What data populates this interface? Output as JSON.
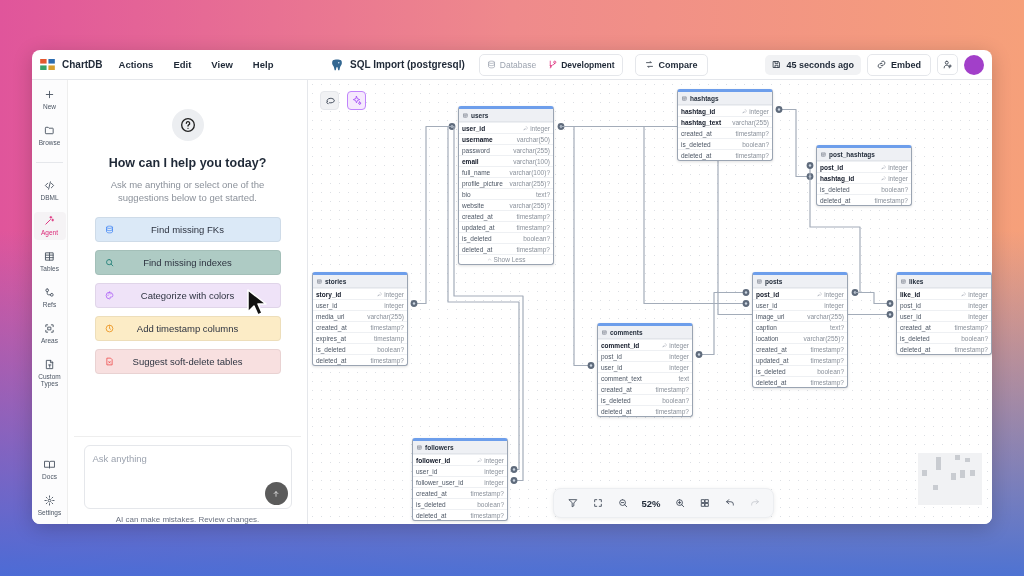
{
  "app": {
    "name": "ChartDB"
  },
  "menu": [
    "Actions",
    "Edit",
    "View",
    "Help"
  ],
  "diagram": {
    "name": "SQL Import (postgresql)"
  },
  "branches": [
    {
      "label": "Database",
      "selected": false
    },
    {
      "label": "Development",
      "selected": true
    }
  ],
  "compare_button": "Compare",
  "save_status": "45 seconds ago",
  "embed_button": "Embed",
  "rail": {
    "top": [
      {
        "label": "New",
        "selected": false
      },
      {
        "label": "Browse",
        "selected": false
      }
    ],
    "main": [
      {
        "label": "DBML",
        "selected": false
      },
      {
        "label": "Agent",
        "selected": true
      },
      {
        "label": "Tables",
        "selected": false
      },
      {
        "label": "Refs",
        "selected": false
      },
      {
        "label": "Areas",
        "selected": false
      },
      {
        "label": "Custom Types",
        "selected": false
      }
    ],
    "bottom": [
      {
        "label": "Docs",
        "selected": false
      },
      {
        "label": "Settings",
        "selected": false
      }
    ]
  },
  "agent": {
    "heading": "How can I help you today?",
    "subtitle": "Ask me anything or select one of the suggestions below to get started.",
    "suggestions": [
      {
        "label": "Find missing FKs",
        "color": "#dbe9f7"
      },
      {
        "label": "Find missing indexes",
        "color": "#aecbc4"
      },
      {
        "label": "Categorize with colors",
        "color": "#efe3f8"
      },
      {
        "label": "Add timestamp columns",
        "color": "#fcecc6"
      },
      {
        "label": "Suggest soft-delete tables",
        "color": "#f8e0e0"
      }
    ],
    "input": {
      "placeholder": "Ask anything"
    },
    "disclaimer": "AI can make mistakes. Review changes."
  },
  "canvas_tools": [
    {
      "selected": false
    },
    {
      "selected": true
    }
  ],
  "tables": [
    {
      "name": "users",
      "toggle": "Show Less",
      "fields": [
        {
          "name": "user_id",
          "type": "integer",
          "primary": true,
          "unique": false
        },
        {
          "name": "username",
          "type": "varchar(50)",
          "primary": false,
          "unique": true
        },
        {
          "name": "password",
          "type": "varchar(255)",
          "primary": false,
          "unique": false
        },
        {
          "name": "email",
          "type": "varchar(100)",
          "primary": false,
          "unique": true
        },
        {
          "name": "full_name",
          "type": "varchar(100)?",
          "primary": false,
          "unique": false
        },
        {
          "name": "profile_picture",
          "type": "varchar(255)?",
          "primary": false,
          "unique": false
        },
        {
          "name": "bio",
          "type": "text?",
          "primary": false,
          "unique": false
        },
        {
          "name": "website",
          "type": "varchar(255)?",
          "primary": false,
          "unique": false
        },
        {
          "name": "created_at",
          "type": "timestamp?",
          "primary": false,
          "unique": false
        },
        {
          "name": "updated_at",
          "type": "timestamp?",
          "primary": false,
          "unique": false
        },
        {
          "name": "is_deleted",
          "type": "boolean?",
          "primary": false,
          "unique": false
        },
        {
          "name": "deleted_at",
          "type": "timestamp?",
          "primary": false,
          "unique": false
        }
      ]
    },
    {
      "name": "hashtags",
      "fields": [
        {
          "name": "hashtag_id",
          "type": "integer",
          "primary": true,
          "unique": false
        },
        {
          "name": "hashtag_text",
          "type": "varchar(255)",
          "primary": false,
          "unique": true
        },
        {
          "name": "created_at",
          "type": "timestamp?",
          "primary": false,
          "unique": false
        },
        {
          "name": "is_deleted",
          "type": "boolean?",
          "primary": false,
          "unique": false
        },
        {
          "name": "deleted_at",
          "type": "timestamp?",
          "primary": false,
          "unique": false
        }
      ]
    },
    {
      "name": "post_hashtags",
      "fields": [
        {
          "name": "post_id",
          "type": "integer",
          "primary": true,
          "unique": false
        },
        {
          "name": "hashtag_id",
          "type": "integer",
          "primary": true,
          "unique": false
        },
        {
          "name": "is_deleted",
          "type": "boolean?",
          "primary": false,
          "unique": false
        },
        {
          "name": "deleted_at",
          "type": "timestamp?",
          "primary": false,
          "unique": false
        }
      ]
    },
    {
      "name": "stories",
      "fields": [
        {
          "name": "story_id",
          "type": "integer",
          "primary": true,
          "unique": false
        },
        {
          "name": "user_id",
          "type": "integer",
          "primary": false,
          "unique": false
        },
        {
          "name": "media_url",
          "type": "varchar(255)",
          "primary": false,
          "unique": false
        },
        {
          "name": "created_at",
          "type": "timestamp?",
          "primary": false,
          "unique": false
        },
        {
          "name": "expires_at",
          "type": "timestamp",
          "primary": false,
          "unique": false
        },
        {
          "name": "is_deleted",
          "type": "boolean?",
          "primary": false,
          "unique": false
        },
        {
          "name": "deleted_at",
          "type": "timestamp?",
          "primary": false,
          "unique": false
        }
      ]
    },
    {
      "name": "posts",
      "fields": [
        {
          "name": "post_id",
          "type": "integer",
          "primary": true,
          "unique": false
        },
        {
          "name": "user_id",
          "type": "integer",
          "primary": false,
          "unique": false
        },
        {
          "name": "image_url",
          "type": "varchar(255)",
          "primary": false,
          "unique": false
        },
        {
          "name": "caption",
          "type": "text?",
          "primary": false,
          "unique": false
        },
        {
          "name": "location",
          "type": "varchar(255)?",
          "primary": false,
          "unique": false
        },
        {
          "name": "created_at",
          "type": "timestamp?",
          "primary": false,
          "unique": false
        },
        {
          "name": "updated_at",
          "type": "timestamp?",
          "primary": false,
          "unique": false
        },
        {
          "name": "is_deleted",
          "type": "boolean?",
          "primary": false,
          "unique": false
        },
        {
          "name": "deleted_at",
          "type": "timestamp?",
          "primary": false,
          "unique": false
        }
      ]
    },
    {
      "name": "likes",
      "fields": [
        {
          "name": "like_id",
          "type": "integer",
          "primary": true,
          "unique": false
        },
        {
          "name": "post_id",
          "type": "integer",
          "primary": false,
          "unique": false
        },
        {
          "name": "user_id",
          "type": "integer",
          "primary": false,
          "unique": false
        },
        {
          "name": "created_at",
          "type": "timestamp?",
          "primary": false,
          "unique": false
        },
        {
          "name": "is_deleted",
          "type": "boolean?",
          "primary": false,
          "unique": false
        },
        {
          "name": "deleted_at",
          "type": "timestamp?",
          "primary": false,
          "unique": false
        }
      ]
    },
    {
      "name": "comments",
      "fields": [
        {
          "name": "comment_id",
          "type": "integer",
          "primary": true,
          "unique": false
        },
        {
          "name": "post_id",
          "type": "integer",
          "primary": false,
          "unique": false
        },
        {
          "name": "user_id",
          "type": "integer",
          "primary": false,
          "unique": false
        },
        {
          "name": "comment_text",
          "type": "text",
          "primary": false,
          "unique": false
        },
        {
          "name": "created_at",
          "type": "timestamp?",
          "primary": false,
          "unique": false
        },
        {
          "name": "is_deleted",
          "type": "boolean?",
          "primary": false,
          "unique": false
        },
        {
          "name": "deleted_at",
          "type": "timestamp?",
          "primary": false,
          "unique": false
        }
      ]
    },
    {
      "name": "followers",
      "fields": [
        {
          "name": "follower_id",
          "type": "integer",
          "primary": true,
          "unique": false
        },
        {
          "name": "user_id",
          "type": "integer",
          "primary": false,
          "unique": false
        },
        {
          "name": "follower_user_id",
          "type": "integer",
          "primary": false,
          "unique": false
        },
        {
          "name": "created_at",
          "type": "timestamp?",
          "primary": false,
          "unique": false
        },
        {
          "name": "is_deleted",
          "type": "boolean?",
          "primary": false,
          "unique": false
        },
        {
          "name": "deleted_at",
          "type": "timestamp?",
          "primary": false,
          "unique": false
        }
      ]
    }
  ],
  "toolbar": {
    "zoom": "52%",
    "undo_disabled": false,
    "redo_disabled": true
  }
}
